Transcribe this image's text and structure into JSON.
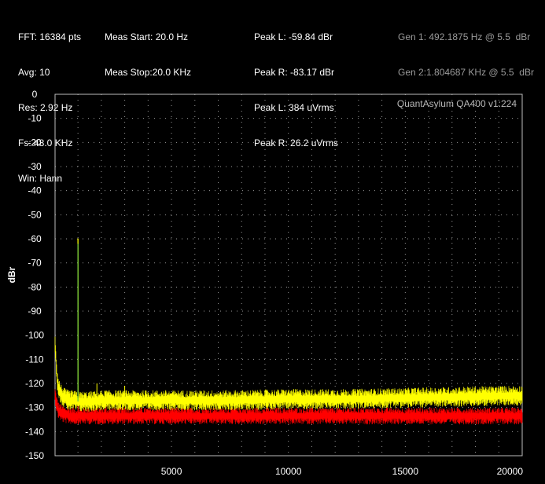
{
  "header": {
    "col1": [
      "FFT: 16384 pts",
      "Avg: 10",
      "Res: 2.92 Hz",
      "Fs: 48.0 KHz",
      "Win: Hann"
    ],
    "col2": [
      "Meas Start: 20.0 Hz",
      "Meas Stop:20.0 KHz"
    ],
    "col3": [
      "Peak L: -59.84 dBr",
      "Peak R: -83.17 dBr",
      "Peak L: 384 uVrms",
      "Peak R: 26.2 uVrms"
    ],
    "col4": [
      "Gen 1: 492.1875 Hz @ 5.5  dBr",
      "Gen 2:1.804687 KHz @ 5.5  dBr"
    ]
  },
  "chart_data": {
    "type": "line",
    "watermark": "QuantAsylum QA400 v1:224",
    "ylabel": "dBr",
    "xlabel": "",
    "xlim": [
      20,
      20000
    ],
    "ylim": [
      -150,
      0
    ],
    "xticks": [
      5000,
      10000,
      15000,
      20000
    ],
    "yticks": [
      0,
      -10,
      -20,
      -30,
      -40,
      -50,
      -60,
      -70,
      -80,
      -90,
      -100,
      -110,
      -120,
      -130,
      -140,
      -150
    ],
    "grid": true,
    "colors": {
      "background": "#000000",
      "grid": "#9a9a9a",
      "left": "#ffff00",
      "right": "#ff0000"
    },
    "series": [
      {
        "channel": "left",
        "color": "#ffff00",
        "x": [
          20,
          100,
          150,
          250,
          400,
          600,
          800,
          1000,
          1500,
          2000,
          3000,
          5000,
          7500,
          10000,
          12500,
          15000,
          17500,
          20000
        ],
        "y": [
          -103,
          -117,
          -121,
          -124,
          -126,
          -127,
          -127,
          -127.5,
          -127.5,
          -127,
          -127,
          -127,
          -127,
          -126.5,
          -126.5,
          -126,
          -125.5,
          -125
        ],
        "noise": 3,
        "spikes": [
          {
            "x": 1000,
            "y": -121
          },
          {
            "x": 1810,
            "y": -120
          },
          {
            "x": 2200,
            "y": -123
          },
          {
            "x": 3000,
            "y": -121
          },
          {
            "x": 5220,
            "y": -124
          },
          {
            "x": 7400,
            "y": -125
          }
        ]
      },
      {
        "channel": "right",
        "color": "#ff0000",
        "x": [
          20,
          100,
          150,
          250,
          400,
          800,
          1500,
          3000,
          5000,
          10000,
          15000,
          20000
        ],
        "y": [
          -125,
          -129,
          -131,
          -132,
          -133,
          -133.5,
          -133.5,
          -133.5,
          -133.5,
          -133.5,
          -133.5,
          -133.5
        ],
        "noise": 2.5,
        "spikes": [
          {
            "x": 1000,
            "y": -129
          },
          {
            "x": 2200,
            "y": -129
          },
          {
            "x": 3000,
            "y": -130
          },
          {
            "x": 3600,
            "y": -131
          }
        ]
      }
    ],
    "peaks": [
      {
        "channel": "left",
        "color": "#ffff00",
        "x": 1000,
        "y": -59.84
      },
      {
        "channel": "left",
        "color": "#6fc43a",
        "x": 1000,
        "y": -62
      }
    ]
  }
}
